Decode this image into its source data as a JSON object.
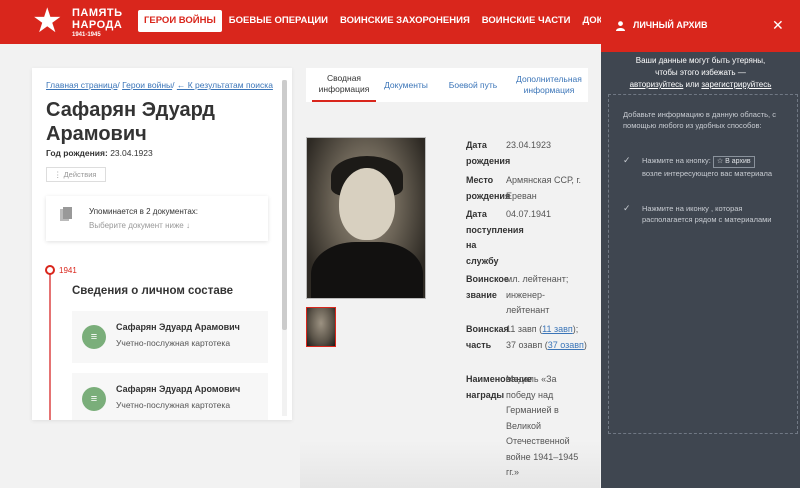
{
  "header": {
    "logo_line1": "ПАМЯТЬ",
    "logo_line2": "НАРОДА",
    "logo_years": "1941-1945",
    "nav": [
      "ГЕРОИ ВОЙНЫ",
      "БОЕВЫЕ ОПЕРАЦИИ",
      "ВОИНСКИЕ ЗАХОРОНЕНИЯ",
      "ВОИНСКИЕ ЧАСТИ",
      "ДОКУМЕНТЫ ЧАСТЕЙ"
    ],
    "colors": {
      "brand_red": "#d9261c",
      "panel_dark": "#3f4650",
      "link_blue": "#3b75b8"
    }
  },
  "breadcrumbs": [
    "Главная страница",
    "Герои войны",
    "← К результатам поиска"
  ],
  "person": {
    "name": "Сафарян Эдуард Арамович",
    "birth_label": "Год рождения:",
    "birth_value": "23.04.1923",
    "actions_label": "⋮ Действия"
  },
  "mentions": {
    "title": "Упоминается в 2 документах:",
    "hint": "Выберите документ ниже ↓"
  },
  "timeline": {
    "year": "1941",
    "section_title": "Сведения о личном составе",
    "cards": [
      {
        "name": "Сафарян Эдуард Арамович",
        "type": "Учетно-послужная картотека"
      },
      {
        "name": "Сафарян Эдуард Аромович",
        "type": "Учетно-послужная картотека"
      }
    ]
  },
  "tabs": [
    {
      "label": "Сводная информация",
      "active": true
    },
    {
      "label": "Документы",
      "active": false
    },
    {
      "label": "Боевой путь",
      "active": false
    },
    {
      "label": "Дополнительная информация",
      "active": false
    }
  ],
  "info": {
    "birth_date_label": "Дата рождения",
    "birth_date_value": "23.04.1923",
    "birthplace_label": "Место рождения",
    "birthplace_value": "Армянская ССР, г. Ереван",
    "enlist_label": "Дата поступления на службу",
    "enlist_value": "04.07.1941",
    "rank_label": "Воинское звание",
    "rank_value": "мл. лейтенант; инженер-лейтенант",
    "unit_label": "Воинская часть",
    "unit_pre": "11 завп (",
    "unit_link1": "11 завп",
    "unit_mid": "); 37 озавп (",
    "unit_link2": "37 озавп",
    "unit_post": ")",
    "award_label": "Наименование награды",
    "award_value": "Медаль «За победу над Германией в Великой Отечественной войне 1941–1945 гг.»"
  },
  "archive_panel": {
    "title": "ЛИЧНЫЙ АРХИВ",
    "close": "✕",
    "warning_line1": "Ваши данные могут быть утеряны,",
    "warning_line2_pre": "чтобы этого избежать —",
    "login_link": "авторизуйтесь",
    "or": " или ",
    "register_link": "зарегистрируйтесь",
    "intro": "Добавьте информацию в данную область, с помощью любого из удобных способов:",
    "step1_pre": "Нажмите на кнопку:",
    "step1_button": "☆ В архив",
    "step1_post": "возле интересующего вас материала",
    "step2": "Нажмите на иконку , которая располагается рядом с материалами"
  }
}
